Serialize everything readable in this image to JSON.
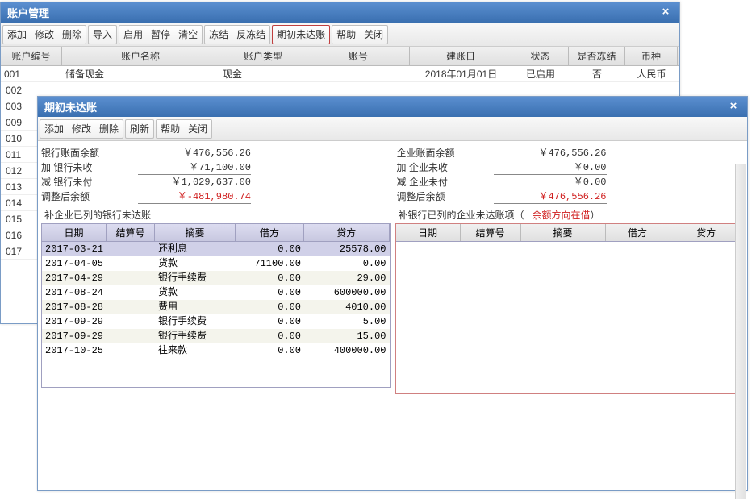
{
  "parent": {
    "title": "账户管理",
    "toolbar_groups": [
      [
        "添加",
        "修改",
        "删除"
      ],
      [
        "导入"
      ],
      [
        "启用",
        "暂停",
        "清空"
      ],
      [
        "冻结",
        "反冻结"
      ],
      [
        "期初未达账"
      ],
      [
        "帮助",
        "关闭"
      ]
    ],
    "highlight_group_index": 4,
    "columns": [
      "账户编号",
      "账户名称",
      "账户类型",
      "账号",
      "建账日",
      "状态",
      "是否冻结",
      "币种"
    ],
    "rows": [
      {
        "id": "001",
        "name": "储备现金",
        "type": "现金",
        "acct": "",
        "date": "2018年01月01日",
        "status": "已启用",
        "frozen": "否",
        "currency": "人民币"
      }
    ],
    "row_ids": [
      "002",
      "003",
      "009",
      "010",
      "011",
      "012",
      "013",
      "014",
      "015",
      "016",
      "017"
    ]
  },
  "child": {
    "title": "期初未达账",
    "toolbar_groups": [
      [
        "添加",
        "修改",
        "删除"
      ],
      [
        "刷新"
      ],
      [
        "帮助",
        "关闭"
      ]
    ],
    "left_summary": [
      {
        "label": "银行账面余额",
        "value": "￥476,556.26",
        "red": false
      },
      {
        "label": "加 银行未收",
        "value": "￥71,100.00",
        "red": false
      },
      {
        "label": "减 银行未付",
        "value": "￥1,029,637.00",
        "red": false
      },
      {
        "label": "调整后余额",
        "value": "￥-481,980.74",
        "red": true
      }
    ],
    "right_summary": [
      {
        "label": "企业账面余额",
        "value": "￥476,556.26",
        "red": false
      },
      {
        "label": "加 企业未收",
        "value": "￥0.00",
        "red": false
      },
      {
        "label": "减 企业未付",
        "value": "￥0.00",
        "red": false
      },
      {
        "label": "调整后余额",
        "value": "￥476,556.26",
        "red": true
      }
    ],
    "left_caption": "补企业已列的银行未达账",
    "right_caption": "补银行已列的企业未达账项（",
    "right_caption_note": "余额方向在借",
    "right_caption_close": "）",
    "detail_columns": [
      "日期",
      "结算号",
      "摘要",
      "借方",
      "贷方"
    ],
    "left_rows": [
      {
        "date": "2017-03-21",
        "settle": "",
        "summary": "还利息",
        "debit": "0.00",
        "credit": "25578.00",
        "sel": true
      },
      {
        "date": "2017-04-05",
        "settle": "",
        "summary": "货款",
        "debit": "71100.00",
        "credit": "0.00"
      },
      {
        "date": "2017-04-29",
        "settle": "",
        "summary": "银行手续费",
        "debit": "0.00",
        "credit": "29.00"
      },
      {
        "date": "2017-08-24",
        "settle": "",
        "summary": "货款",
        "debit": "0.00",
        "credit": "600000.00"
      },
      {
        "date": "2017-08-28",
        "settle": "",
        "summary": "费用",
        "debit": "0.00",
        "credit": "4010.00"
      },
      {
        "date": "2017-09-29",
        "settle": "",
        "summary": "银行手续费",
        "debit": "0.00",
        "credit": "5.00"
      },
      {
        "date": "2017-09-29",
        "settle": "",
        "summary": "银行手续费",
        "debit": "0.00",
        "credit": "15.00"
      },
      {
        "date": "2017-10-25",
        "settle": "",
        "summary": "往来款",
        "debit": "0.00",
        "credit": "400000.00"
      }
    ],
    "right_rows": []
  }
}
